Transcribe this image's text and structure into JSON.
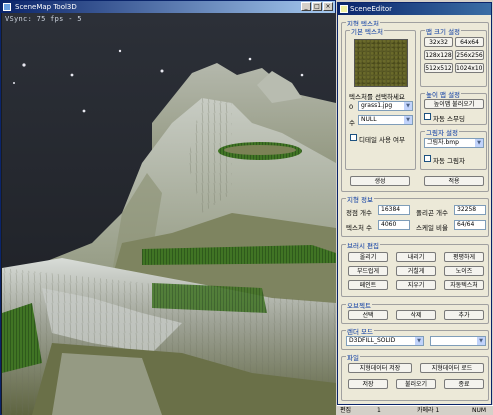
{
  "viewport": {
    "title": "SceneMap Tool3D",
    "fps_readout": "VSync: 75 fps  -  5"
  },
  "editor": {
    "title": "SceneEditor",
    "terrain_group": "지형 텍스처",
    "base_texture_group": "기본 텍스처",
    "texture_hint": "텍스처를 선택하세요",
    "texture_index": "0",
    "texture_file": "grass1.jpg",
    "sub_label": "수",
    "sub_value": "NULL",
    "use_detail": "디테일 사용 여부",
    "size_group": "맵 크기 설정",
    "sizes": [
      "32x32",
      "64x64",
      "128x128",
      "256x256",
      "512x512",
      "1024x1024"
    ],
    "height_group": "높이 맵 설정",
    "height_button": "높이맵 불러오기",
    "auto_smooth": "자동 스무딩",
    "shadow_group": "그림자 설정",
    "shadow_file": "그림자.bmp",
    "auto_shadow": "자동 그림자",
    "create_button": "생성",
    "apply_button": "적용",
    "info_group": "지형 정보",
    "info": {
      "vertex_label": "정점 개수",
      "vertex_value": "16384",
      "poly_label": "폴리곤 개수",
      "poly_value": "32258",
      "tex_label": "텍스처 수",
      "tex_value": "4060",
      "ratio_label": "스케일 비율",
      "ratio_value": "64/64"
    },
    "brush_group": "브러시 편집",
    "brush_buttons": [
      "올리기",
      "내리기",
      "평평하게",
      "부드럽게",
      "거칠게",
      "노이즈",
      "페인트",
      "지우기",
      "자동텍스처"
    ],
    "object_group": "오브젝트",
    "object_buttons": [
      "선택",
      "삭제",
      "추가"
    ],
    "render_group": "렌더 모드",
    "render_mode": "D3DFILL_SOLID",
    "render_mode2": "",
    "file_group": "파일",
    "save_button": "지형데이터 저장",
    "load_button": "지형데이터 로드",
    "bottom_buttons": [
      "저장",
      "불러오기",
      "종료"
    ]
  },
  "status": {
    "item1": "편집",
    "item2": "1",
    "item3": "카메라 1",
    "item4": "NUM"
  },
  "colors": {
    "titlebar": "#0a246a",
    "panel_bg": "#ece9d8",
    "group_label": "#0033a0"
  }
}
